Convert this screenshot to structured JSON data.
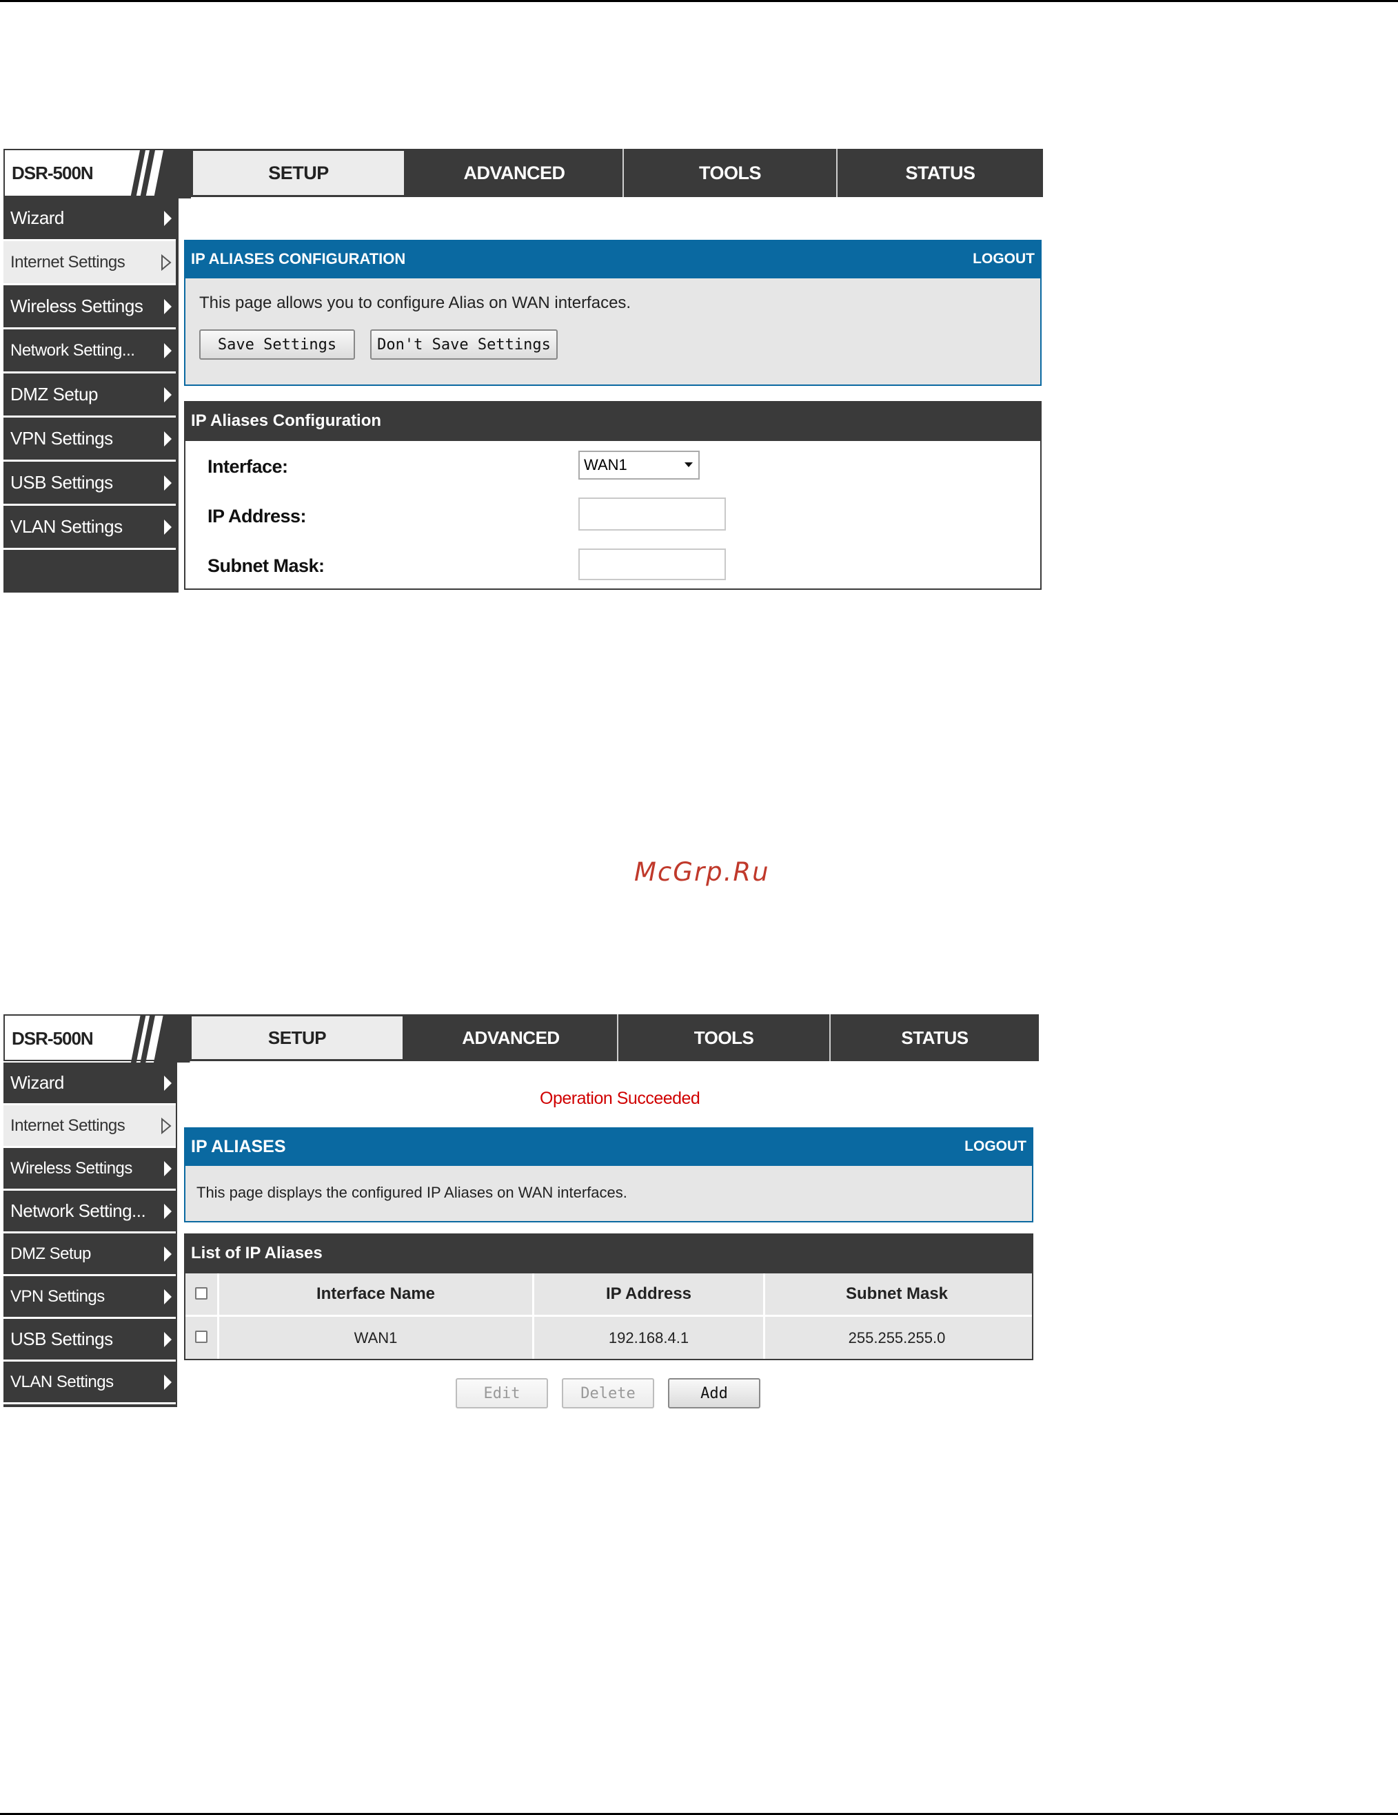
{
  "watermark": "McGrp.Ru",
  "shot1": {
    "brand": "DSR-500N",
    "tabs": [
      "SETUP",
      "ADVANCED",
      "TOOLS",
      "STATUS"
    ],
    "sidebar": [
      "Wizard",
      "Internet Settings",
      "Wireless Settings",
      "Network Setting...",
      "DMZ Setup",
      "VPN Settings",
      "USB Settings",
      "VLAN Settings"
    ],
    "header_title": "IP ALIASES CONFIGURATION",
    "logout": "LOGOUT",
    "description": "This page allows you to configure Alias on WAN interfaces.",
    "save_button": "Save Settings",
    "dont_save_button": "Don't Save Settings",
    "section_title": "IP Aliases Configuration",
    "form": {
      "interface_label": "Interface:",
      "interface_value": "WAN1",
      "ip_label": "IP Address:",
      "ip_value": "",
      "mask_label": "Subnet Mask:",
      "mask_value": ""
    }
  },
  "shot2": {
    "brand": "DSR-500N",
    "tabs": [
      "SETUP",
      "ADVANCED",
      "TOOLS",
      "STATUS"
    ],
    "sidebar": [
      "Wizard",
      "Internet Settings",
      "Wireless Settings",
      "Network Setting...",
      "DMZ Setup",
      "VPN Settings",
      "USB Settings",
      "VLAN Settings"
    ],
    "status_message": "Operation Succeeded",
    "header_title": "IP ALIASES",
    "logout": "LOGOUT",
    "description": "This page displays the configured IP Aliases on WAN interfaces.",
    "section_title": "List of IP Aliases",
    "table": {
      "columns": [
        "Interface Name",
        "IP Address",
        "Subnet Mask"
      ],
      "rows": [
        {
          "interface": "WAN1",
          "ip": "192.168.4.1",
          "mask": "255.255.255.0"
        }
      ]
    },
    "buttons": {
      "edit": "Edit",
      "delete": "Delete",
      "add": "Add"
    }
  },
  "colors": {
    "header_blue": "#0a69a1",
    "dark_gray": "#3a3a3a",
    "status_red": "#d00000"
  }
}
